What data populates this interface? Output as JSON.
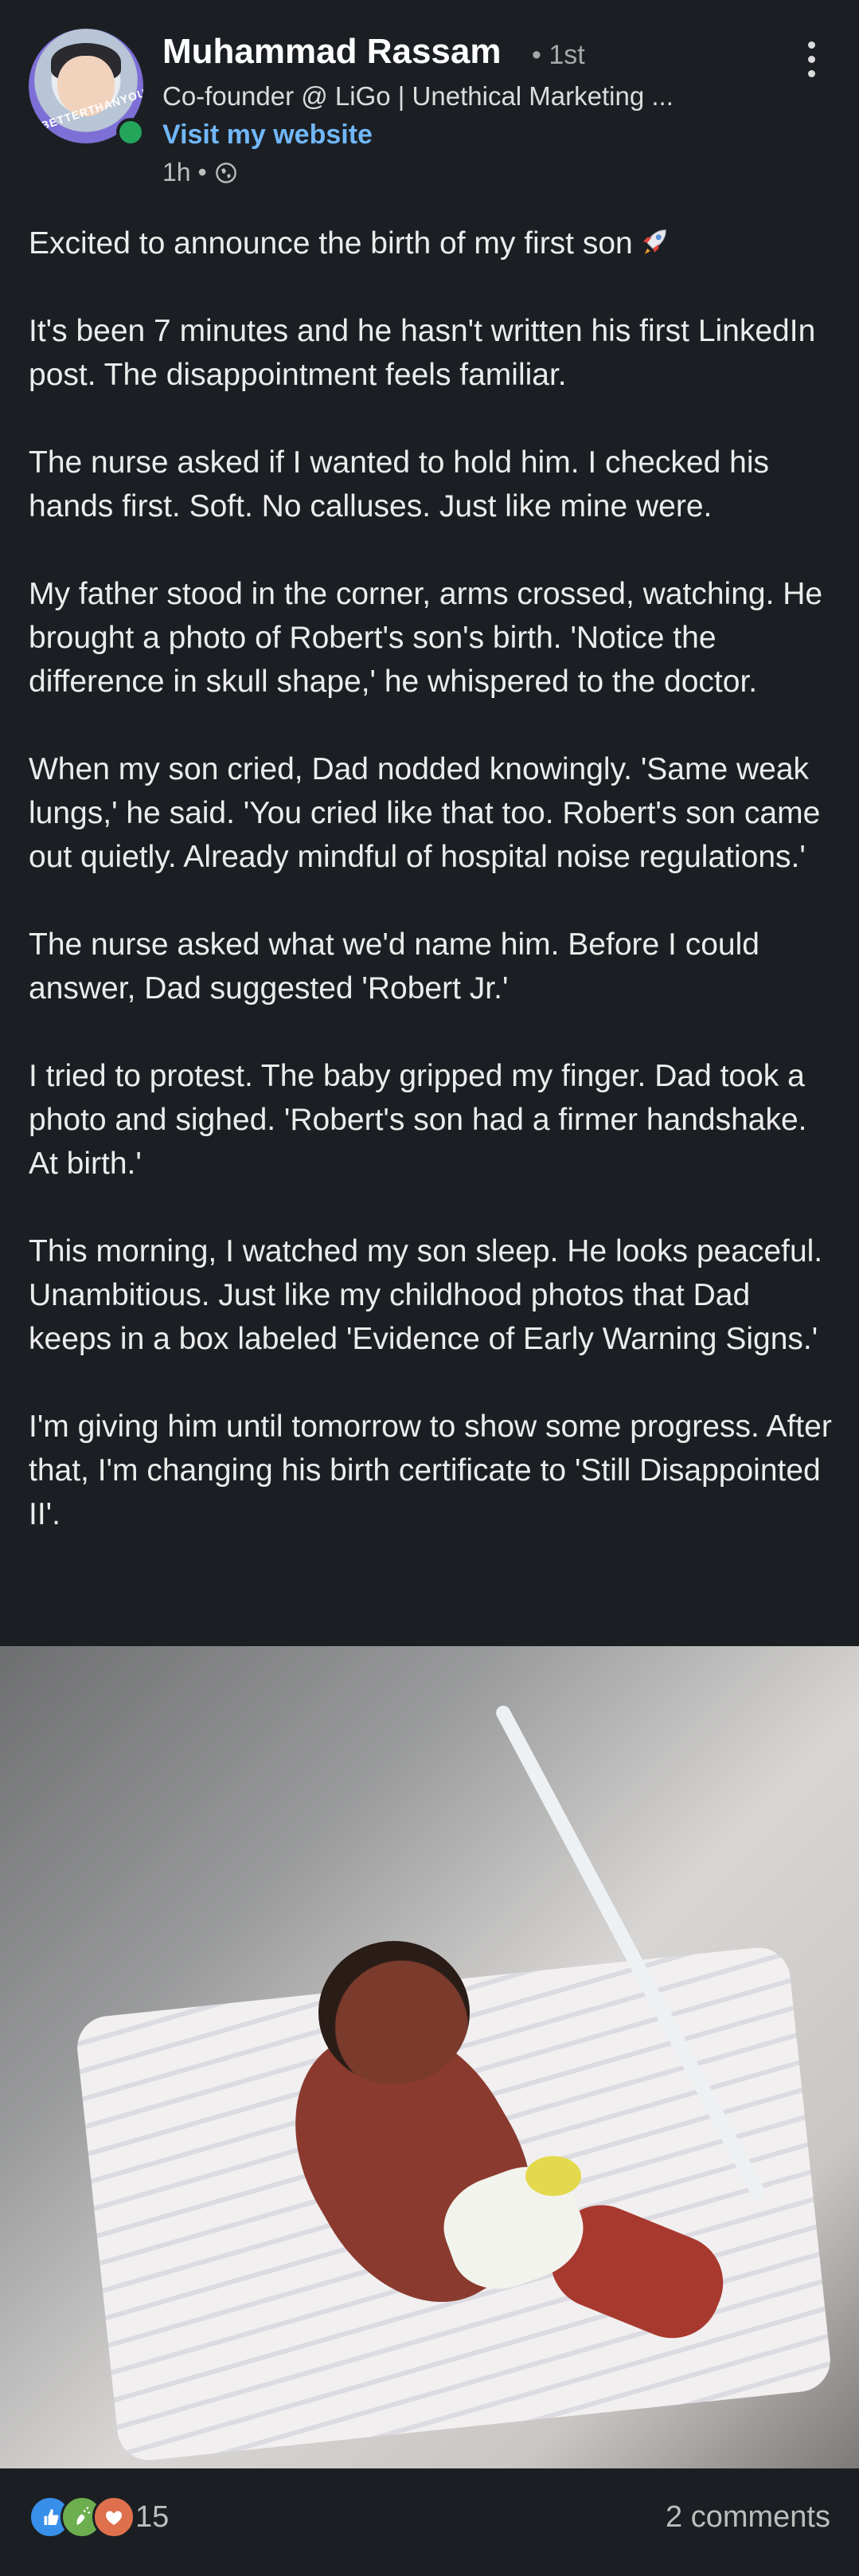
{
  "author": {
    "name": "Muhammad Rassam",
    "degree": "• 1st",
    "headline": "Co-founder @ LiGo | Unethical Marketing ...",
    "website_link": "Visit my website",
    "time": "1h •",
    "avatar_ring_text": "#BETTERTHANYOU"
  },
  "post": {
    "paragraphs": [
      "Excited to announce the birth of my first son",
      "It's been 7 minutes and he hasn't written his first LinkedIn post. The disappointment feels familiar.",
      "The nurse asked if I wanted to hold him. I checked his hands first. Soft. No calluses. Just like mine were.",
      "My father stood in the corner, arms crossed, watching. He brought a photo of Robert's son's birth. 'Notice the difference in skull shape,' he whispered to the doctor.",
      "When my son cried, Dad nodded knowingly. 'Same weak lungs,' he said. 'You cried like that too. Robert's son came out quietly. Already mindful of hospital noise regulations.'",
      "The nurse asked what we'd name him. Before I could answer, Dad suggested 'Robert Jr.'",
      "I tried to protest. The baby gripped my finger. Dad took a photo and sighed. 'Robert's son had a firmer handshake. At birth.'",
      "This morning, I watched my son sleep. He looks peaceful. Unambitious. Just like my childhood photos that Dad keeps in a box labeled 'Evidence of Early Warning Signs.'",
      "I'm giving him until tomorrow to show some progress. After that, I'm changing his birth certificate to 'Still Disappointed II'."
    ],
    "first_line_emoji": "rocket-icon"
  },
  "footer": {
    "reaction_count": "15",
    "comments": "2 comments",
    "reaction_icons": [
      "like-icon",
      "celebrate-icon",
      "support-icon"
    ]
  },
  "colors": {
    "background": "#1b1f23",
    "link": "#71b7fb",
    "online": "#23a55a",
    "like": "#378fe9",
    "celebrate": "#6dae4f",
    "support": "#df704d"
  }
}
